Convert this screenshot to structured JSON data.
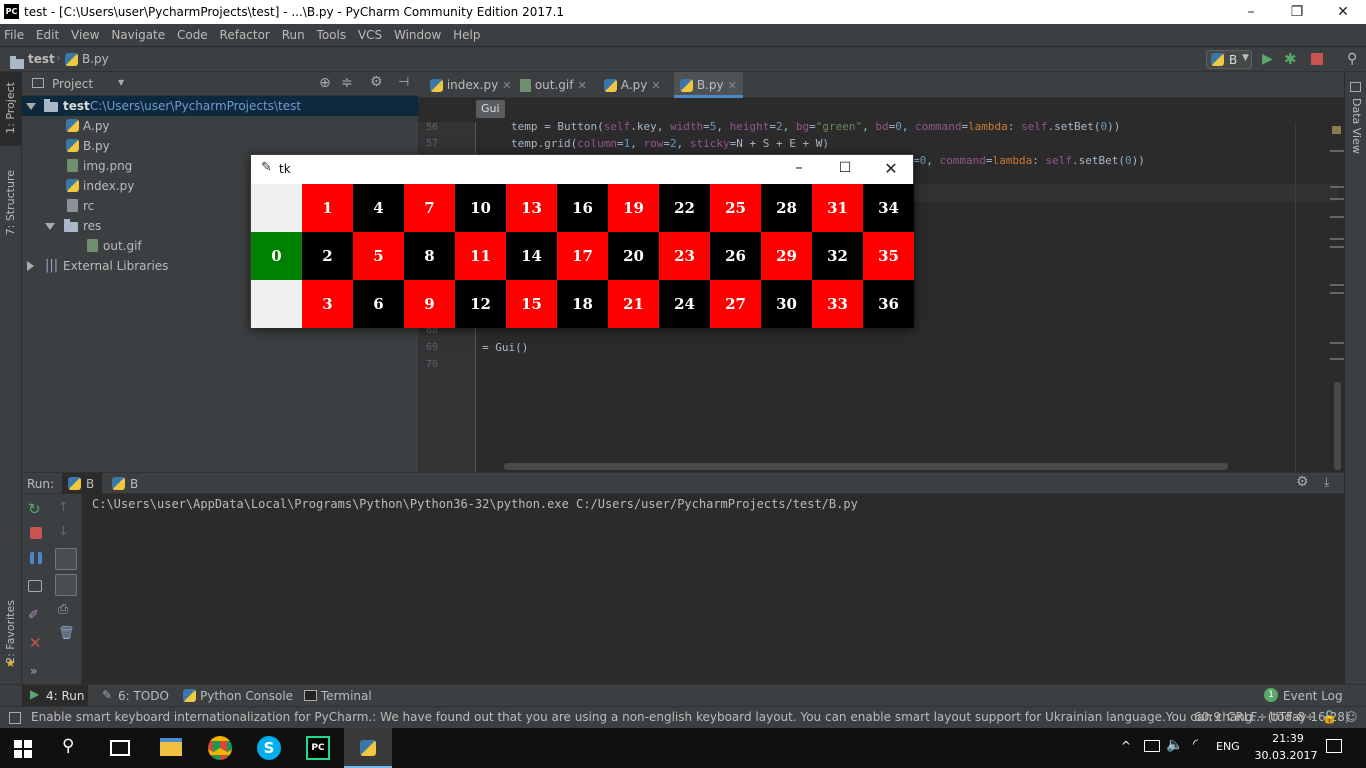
{
  "window": {
    "title": "test - [C:\\Users\\user\\PycharmProjects\\test] - ...\\B.py - PyCharm Community Edition 2017.1",
    "logo": "PC"
  },
  "menu": [
    "File",
    "Edit",
    "View",
    "Navigate",
    "Code",
    "Refactor",
    "Run",
    "Tools",
    "VCS",
    "Window",
    "Help"
  ],
  "breadcrumb": {
    "project": "test",
    "file": "B.py"
  },
  "run_config": {
    "name": "B"
  },
  "left_tools": {
    "project": "1: Project",
    "structure": "7: Structure",
    "favorites": "2: Favorites"
  },
  "right_tools": {
    "data_view": "Data View"
  },
  "project_panel": {
    "header": "Project",
    "root": {
      "name": "test",
      "path": "C:\\Users\\user\\PycharmProjects\\test"
    },
    "items": [
      "A.py",
      "B.py",
      "img.png",
      "index.py",
      "rc",
      "res",
      "out.gif",
      "External Libraries"
    ]
  },
  "editor": {
    "tabs": [
      "index.py",
      "out.gif",
      "A.py",
      "B.py"
    ],
    "breadcrumb_hint": "Gui",
    "line_numbers": [
      "56",
      "57",
      "68",
      "69",
      "70"
    ],
    "code": {
      "l56_a": "temp = Button(",
      "l56_self": "self",
      "l56_b": ".key, ",
      "l56_w": "width",
      "l56_c": "=",
      "l56_wv": "5",
      "l56_d": ", ",
      "l56_h": "height",
      "l56_e": "=",
      "l56_hv": "2",
      "l56_f": ", ",
      "l56_bg": "bg",
      "l56_g": "=",
      "l56_bgv": "\"green\"",
      "l56_h2": ", ",
      "l56_bd": "bd",
      "l56_i": "=",
      "l56_bdv": "0",
      "l56_j": ", ",
      "l56_cmd": "command",
      "l56_k": "=",
      "l56_lam": "lambda",
      "l56_l": ": ",
      "l56_self2": "self",
      "l56_m": ".setBet(",
      "l56_z": "0",
      "l56_n": "))",
      "l57_a": "temp.grid(",
      "l57_col": "column",
      "l57_b": "=",
      "l57_colv": "1",
      "l57_c": ", ",
      "l57_row": "row",
      "l57_d": "=",
      "l57_rowv": "2",
      "l57_e": ", ",
      "l57_st": "sticky",
      "l57_f": "=N + S + E + W)",
      "l58_a": "=",
      "l58_z": "0",
      "l58_b": ", ",
      "l58_cmd": "command",
      "l58_c": "=",
      "l58_lam": "lambda",
      "l58_d": ": ",
      "l58_self": "self",
      "l58_e": ".setBet(",
      "l58_z2": "0",
      "l58_f": "))",
      "l69": "= Gui()"
    }
  },
  "tk_window": {
    "title": "tk",
    "cells": [
      {
        "label": "",
        "color": "blank"
      },
      {
        "label": "1",
        "color": "red"
      },
      {
        "label": "4",
        "color": "black"
      },
      {
        "label": "7",
        "color": "red"
      },
      {
        "label": "10",
        "color": "black"
      },
      {
        "label": "13",
        "color": "red"
      },
      {
        "label": "16",
        "color": "black"
      },
      {
        "label": "19",
        "color": "red"
      },
      {
        "label": "22",
        "color": "black"
      },
      {
        "label": "25",
        "color": "red"
      },
      {
        "label": "28",
        "color": "black"
      },
      {
        "label": "31",
        "color": "red"
      },
      {
        "label": "34",
        "color": "black"
      },
      {
        "label": "0",
        "color": "green"
      },
      {
        "label": "2",
        "color": "black"
      },
      {
        "label": "5",
        "color": "red"
      },
      {
        "label": "8",
        "color": "black"
      },
      {
        "label": "11",
        "color": "red"
      },
      {
        "label": "14",
        "color": "black"
      },
      {
        "label": "17",
        "color": "red"
      },
      {
        "label": "20",
        "color": "black"
      },
      {
        "label": "23",
        "color": "red"
      },
      {
        "label": "26",
        "color": "black"
      },
      {
        "label": "29",
        "color": "red"
      },
      {
        "label": "32",
        "color": "black"
      },
      {
        "label": "35",
        "color": "red"
      },
      {
        "label": "",
        "color": "blank"
      },
      {
        "label": "3",
        "color": "red"
      },
      {
        "label": "6",
        "color": "black"
      },
      {
        "label": "9",
        "color": "red"
      },
      {
        "label": "12",
        "color": "black"
      },
      {
        "label": "15",
        "color": "red"
      },
      {
        "label": "18",
        "color": "black"
      },
      {
        "label": "21",
        "color": "red"
      },
      {
        "label": "24",
        "color": "black"
      },
      {
        "label": "27",
        "color": "red"
      },
      {
        "label": "30",
        "color": "black"
      },
      {
        "label": "33",
        "color": "red"
      },
      {
        "label": "36",
        "color": "black"
      }
    ]
  },
  "run_panel": {
    "label": "Run:",
    "tabs": [
      "B",
      "B"
    ],
    "output": "C:\\Users\\user\\AppData\\Local\\Programs\\Python\\Python36-32\\python.exe C:/Users/user/PycharmProjects/test/B.py"
  },
  "bottom_tabs": {
    "run": "4: Run",
    "todo": "6: TODO",
    "console": "Python Console",
    "terminal": "Terminal",
    "event_log": "Event Log",
    "event_count": "1"
  },
  "status": {
    "message": "Enable smart keyboard internationalization for PyCharm.: We have found out that you are using a non-english keyboard layout. You can enable smart layout support for Ukrainian language.You can chang... (today 16:28)",
    "position": "60:9",
    "line_sep": "CRLF÷",
    "encoding": "UTF-8÷"
  },
  "taskbar": {
    "lang": "ENG",
    "time": "21:39",
    "date": "30.03.2017"
  },
  "colors": {
    "red": "#ff0000",
    "black": "#000000",
    "green": "#008000",
    "accent": "#4a88c7"
  }
}
